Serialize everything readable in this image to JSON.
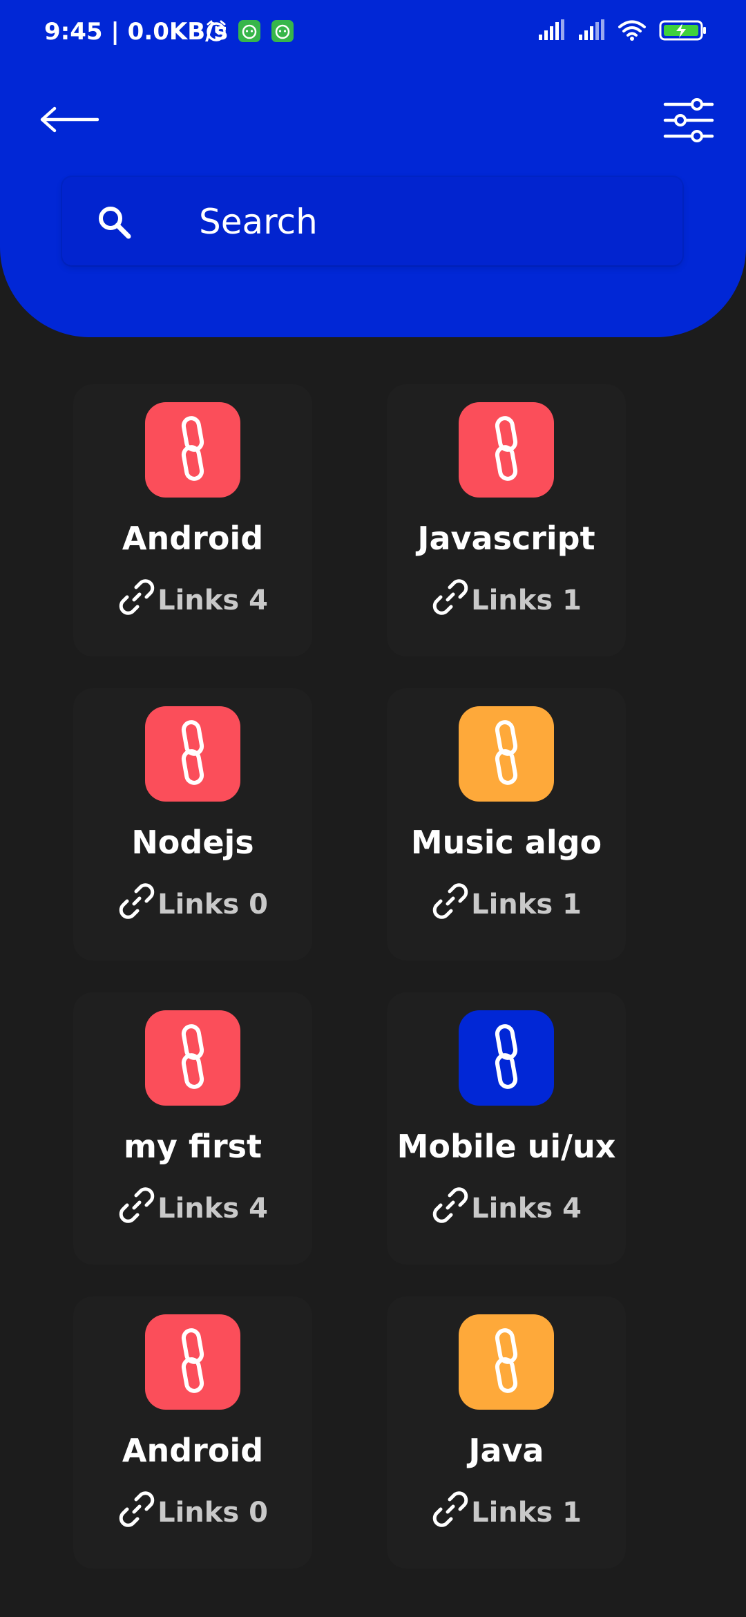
{
  "status_bar": {
    "time": "9:45 | 0.0KB/s",
    "battery_color": "#3fd13c"
  },
  "header": {
    "background": "#0127d6",
    "back_icon": "arrow-left-icon",
    "filter_icon": "sliders-icon"
  },
  "search": {
    "placeholder": "Search",
    "icon": "search-icon"
  },
  "categories": [
    {
      "title": "Android",
      "links_label": "Links 4",
      "icon_color": "#fb4e5a"
    },
    {
      "title": "Javascript",
      "links_label": "Links 1",
      "icon_color": "#fb4e5a"
    },
    {
      "title": "Nodejs",
      "links_label": "Links 0",
      "icon_color": "#fb4e5a"
    },
    {
      "title": "Music algo",
      "links_label": "Links 1",
      "icon_color": "#fea93a"
    },
    {
      "title": "my first",
      "links_label": "Links 4",
      "icon_color": "#fb4e5a"
    },
    {
      "title": "Mobile ui/ux",
      "links_label": "Links 4",
      "icon_color": "#0127d6"
    },
    {
      "title": "Android",
      "links_label": "Links 0",
      "icon_color": "#fb4e5a"
    },
    {
      "title": "Java",
      "links_label": "Links 1",
      "icon_color": "#fea93a"
    }
  ]
}
